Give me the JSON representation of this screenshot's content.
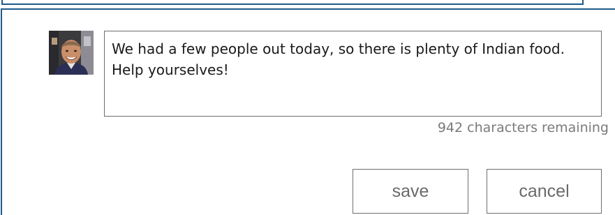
{
  "comment": {
    "text": "We had a few people out today, so there is plenty of Indian food. Help yourselves!",
    "characters_remaining": "942 characters remaining"
  },
  "actions": {
    "save_label": "save",
    "cancel_label": "cancel"
  },
  "colors": {
    "frame_border": "#1e5a8a",
    "field_border": "#6e6e6e",
    "muted_text": "#7a7a7a",
    "button_text": "#6a6a6a"
  },
  "icons": {
    "avatar": "user-avatar-photo"
  }
}
